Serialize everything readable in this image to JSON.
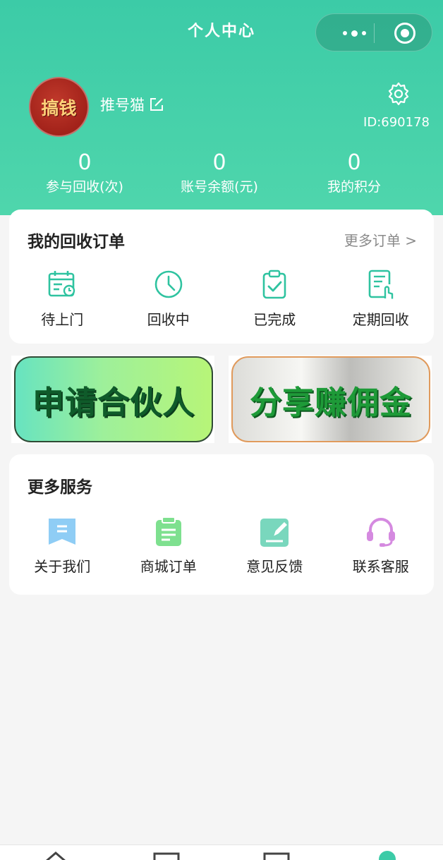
{
  "nav": {
    "title": "个人中心"
  },
  "profile": {
    "avatar_text": "搞钱",
    "nickname": "推号猫",
    "id_text": "ID:690178"
  },
  "stats": [
    {
      "value": "0",
      "label": "参与回收(次)"
    },
    {
      "value": "0",
      "label": "账号余额(元)"
    },
    {
      "value": "0",
      "label": "我的积分"
    }
  ],
  "orders": {
    "title": "我的回收订单",
    "more": "更多订单 >",
    "items": [
      {
        "label": "待上门",
        "icon": "calendar-clock-icon"
      },
      {
        "label": "回收中",
        "icon": "clock-icon"
      },
      {
        "label": "已完成",
        "icon": "clipboard-check-icon"
      },
      {
        "label": "定期回收",
        "icon": "document-touch-icon"
      }
    ]
  },
  "banners": {
    "partner": "申请合伙人",
    "share": "分享赚佣金"
  },
  "services": {
    "title": "更多服务",
    "items": [
      {
        "label": "关于我们",
        "icon": "bookmark-icon",
        "color": "#8fcdf5"
      },
      {
        "label": "商城订单",
        "icon": "clipboard-list-icon",
        "color": "#7ee08f"
      },
      {
        "label": "意见反馈",
        "icon": "edit-note-icon",
        "color": "#79d7bd"
      },
      {
        "label": "联系客服",
        "icon": "headset-icon",
        "color": "#d58ae0"
      }
    ]
  },
  "colors": {
    "primary": "#3ccba7",
    "accent_green": "#1e9a38",
    "partner_text": "#0f5b2a"
  }
}
